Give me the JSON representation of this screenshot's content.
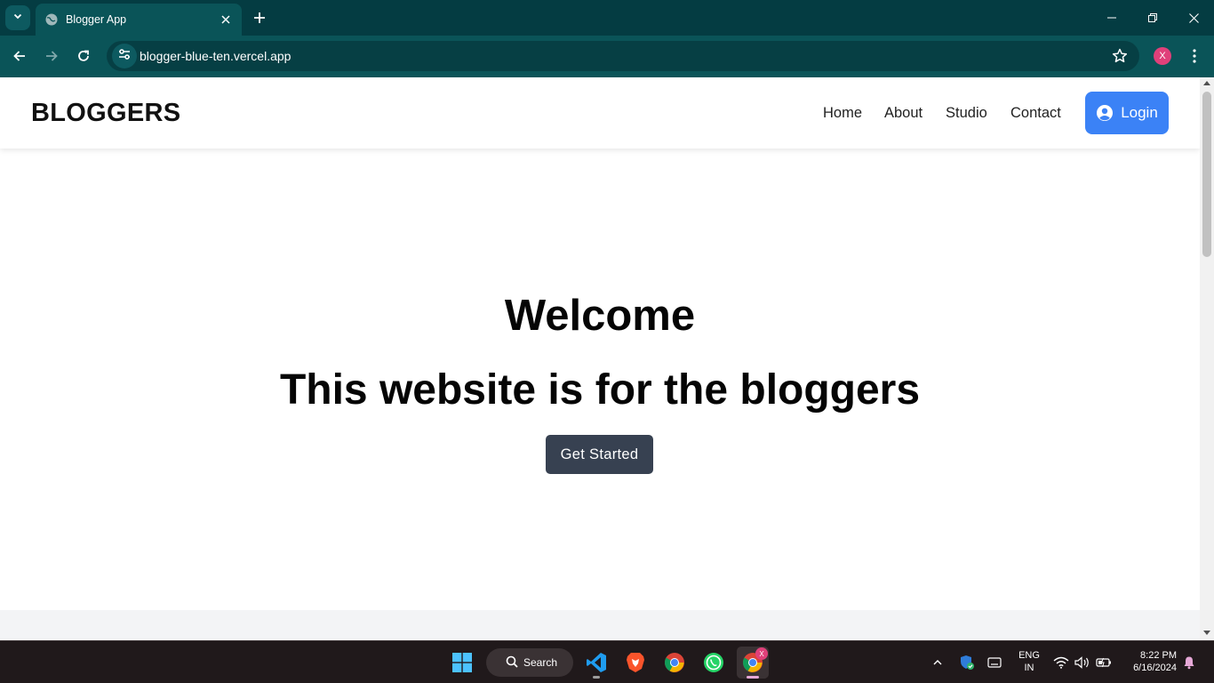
{
  "browser": {
    "tab_title": "Blogger App",
    "url": "blogger-blue-ten.vercel.app",
    "profile_initial": "X",
    "theme_color": "#0a5458"
  },
  "site": {
    "brand": "BLOGGERS",
    "nav": [
      {
        "label": "Home"
      },
      {
        "label": "About"
      },
      {
        "label": "Studio"
      },
      {
        "label": "Contact"
      }
    ],
    "login_label": "Login",
    "login_color": "#3b82f6",
    "hero_title": "Welcome",
    "hero_subtitle": "This website is for the bloggers",
    "cta_label": "Get Started",
    "cta_color": "#374151"
  },
  "taskbar": {
    "search_label": "Search",
    "apps": [
      "windows-start-icon",
      "vscode-icon",
      "brave-icon",
      "chrome-icon",
      "whatsapp-icon",
      "chrome-profile-icon"
    ],
    "chrome_badge": "X",
    "lang_line1": "ENG",
    "lang_line2": "IN",
    "time": "8:22 PM",
    "date": "6/16/2024"
  }
}
